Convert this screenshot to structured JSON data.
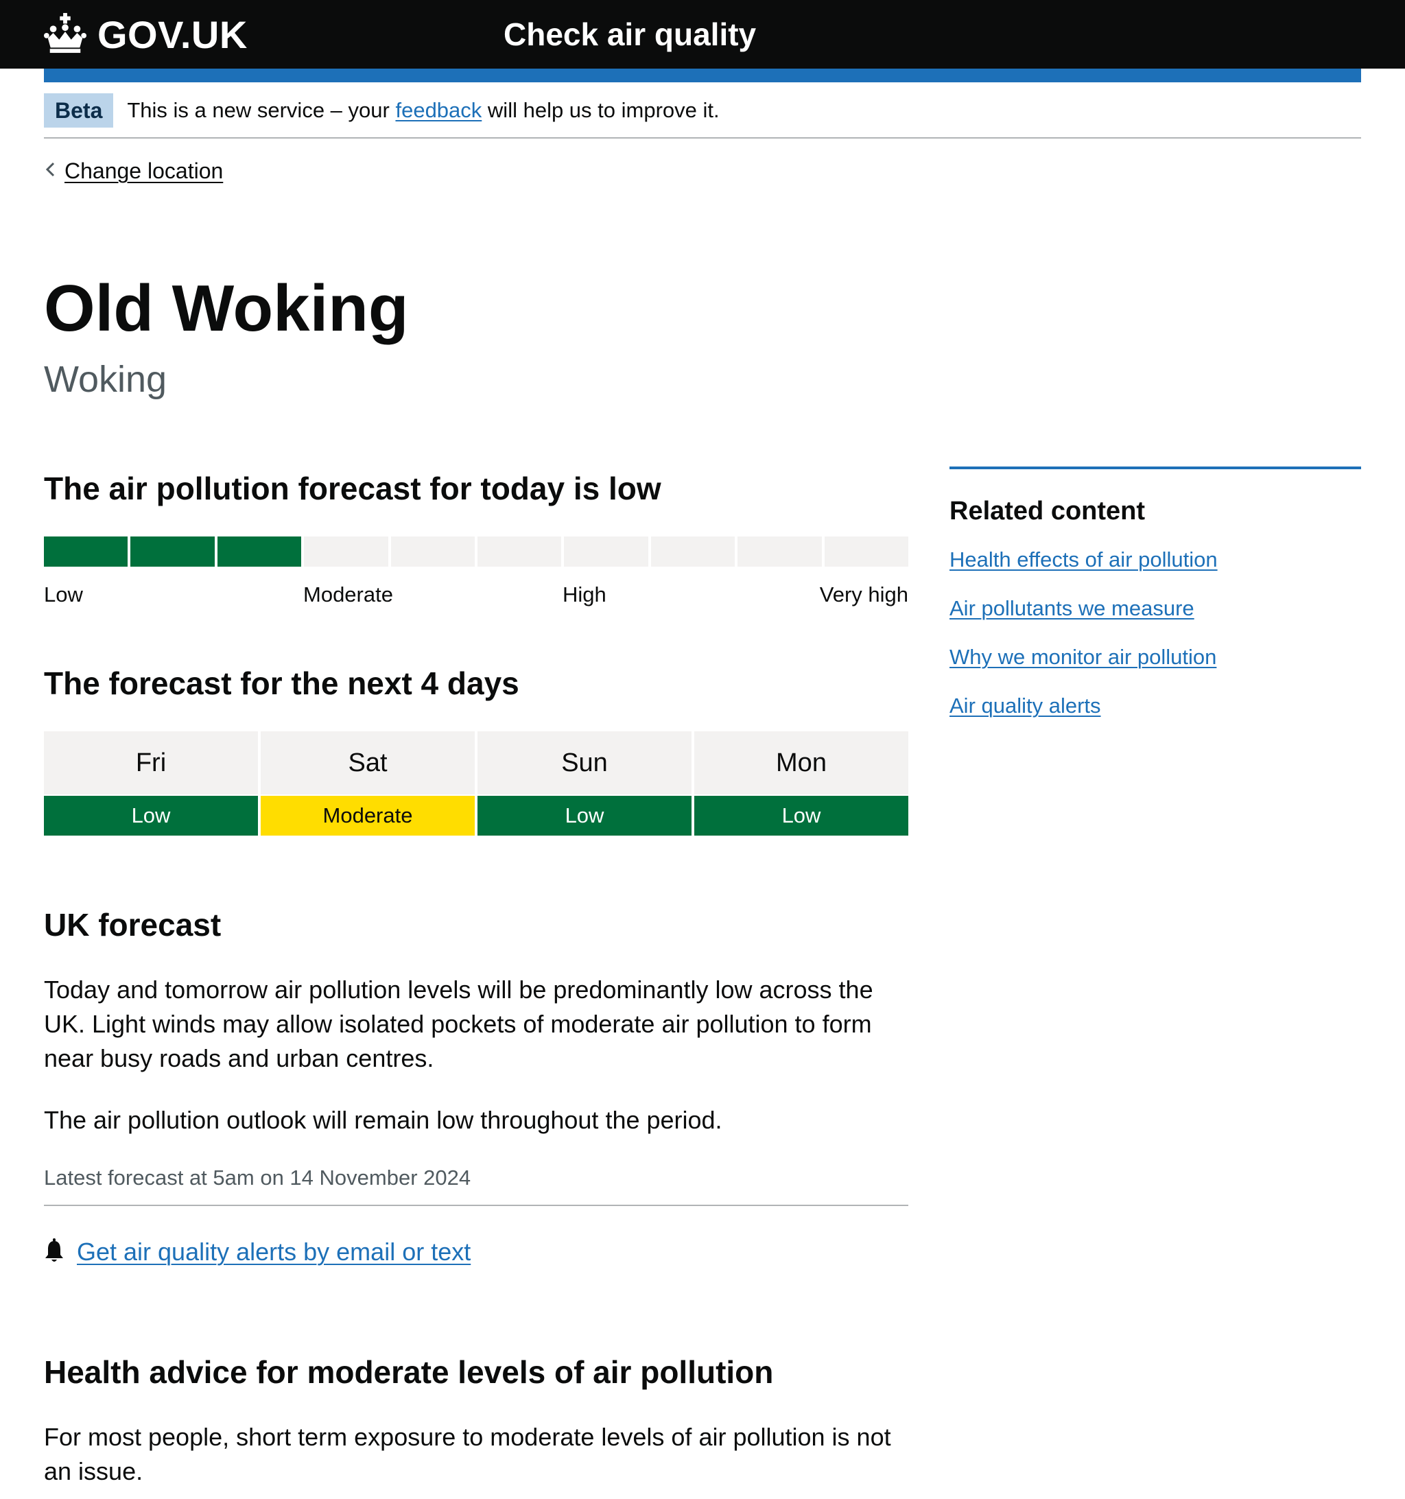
{
  "header": {
    "logo_text": "GOV.UK",
    "service_name": "Check air quality",
    "icons": [
      "crown-icon"
    ],
    "colors": {
      "background": "#0b0c0c",
      "accent_bar": "#1d70b8"
    }
  },
  "phase_banner": {
    "tag": "Beta",
    "text_before": "This is a new service – your",
    "link_text": "feedback",
    "text_after": "will help us to improve it."
  },
  "back_link": {
    "label": "Change location",
    "icon": "chevron-left-icon"
  },
  "location": {
    "title": "Old Woking",
    "subtitle": "Woking"
  },
  "today": {
    "heading": "The air pollution forecast for today is low",
    "level_filled": 3,
    "level_total": 10,
    "colors": {
      "filled": "#00703c",
      "empty": "#f3f2f1"
    },
    "labels": [
      "Low",
      "Moderate",
      "High",
      "Very high"
    ]
  },
  "days": {
    "heading": "The forecast for the next 4 days",
    "items": [
      {
        "day": "Fri",
        "level": "Low",
        "color": "#00703c",
        "text_color": "#ffffff"
      },
      {
        "day": "Sat",
        "level": "Moderate",
        "color": "#ffdd00",
        "text_color": "#0b0c0c"
      },
      {
        "day": "Sun",
        "level": "Low",
        "color": "#00703c",
        "text_color": "#ffffff"
      },
      {
        "day": "Mon",
        "level": "Low",
        "color": "#00703c",
        "text_color": "#ffffff"
      }
    ]
  },
  "uk_forecast": {
    "heading": "UK forecast",
    "paragraph1": "Today and tomorrow air pollution levels will be predominantly low across the UK. Light winds may allow isolated pockets of moderate air pollution to form near busy roads and urban centres.",
    "paragraph2": "The air pollution outlook will remain low throughout the period.",
    "latest": "Latest forecast at 5am on 14 November 2024"
  },
  "alerts": {
    "link_text": "Get air quality alerts by email or text",
    "icon": "bell-icon"
  },
  "health": {
    "heading": "Health advice for moderate levels of air pollution",
    "paragraph": "For most people, short term exposure to moderate levels of air pollution is not an issue."
  },
  "related": {
    "title": "Related content",
    "links": [
      "Health effects of air pollution",
      "Air pollutants we measure",
      "Why we monitor air pollution",
      "Air quality alerts"
    ]
  }
}
